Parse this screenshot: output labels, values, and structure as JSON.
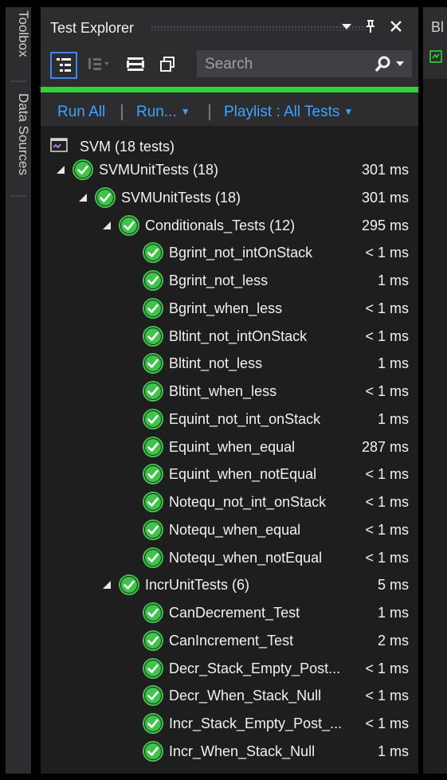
{
  "side_tabs": [
    "Toolbox",
    "Data Sources"
  ],
  "panel": {
    "title": "Test Explorer",
    "search_placeholder": "Search",
    "progress": 1.0,
    "progress_color": "#2bd636",
    "accent_color": "#3ea3ff"
  },
  "actions": {
    "run_all": "Run All",
    "run": "Run...",
    "playlist": "Playlist : All Tests"
  },
  "summary": {
    "label": "SVM (18 tests)"
  },
  "tree": [
    {
      "label": "SVMUnitTests (18)",
      "time": "301 ms",
      "level": 0,
      "expandable": true
    },
    {
      "label": "SVMUnitTests (18)",
      "time": "301 ms",
      "level": 1,
      "expandable": true
    },
    {
      "label": "Conditionals_Tests (12)",
      "time": "295 ms",
      "level": 2,
      "expandable": true
    },
    {
      "label": "Bgrint_not_intOnStack",
      "time": "< 1 ms",
      "level": 3,
      "expandable": false
    },
    {
      "label": "Bgrint_not_less",
      "time": "1 ms",
      "level": 3,
      "expandable": false
    },
    {
      "label": "Bgrint_when_less",
      "time": "< 1 ms",
      "level": 3,
      "expandable": false
    },
    {
      "label": "Bltint_not_intOnStack",
      "time": "< 1 ms",
      "level": 3,
      "expandable": false
    },
    {
      "label": "Bltint_not_less",
      "time": "1 ms",
      "level": 3,
      "expandable": false
    },
    {
      "label": "Bltint_when_less",
      "time": "< 1 ms",
      "level": 3,
      "expandable": false
    },
    {
      "label": "Equint_not_int_onStack",
      "time": "1 ms",
      "level": 3,
      "expandable": false
    },
    {
      "label": "Equint_when_equal",
      "time": "287 ms",
      "level": 3,
      "expandable": false
    },
    {
      "label": "Equint_when_notEqual",
      "time": "< 1 ms",
      "level": 3,
      "expandable": false
    },
    {
      "label": "Notequ_not_int_onStack",
      "time": "< 1 ms",
      "level": 3,
      "expandable": false
    },
    {
      "label": "Notequ_when_equal",
      "time": "< 1 ms",
      "level": 3,
      "expandable": false
    },
    {
      "label": "Notequ_when_notEqual",
      "time": "< 1 ms",
      "level": 3,
      "expandable": false
    },
    {
      "label": "IncrUnitTests (6)",
      "time": "5 ms",
      "level": 2,
      "expandable": true
    },
    {
      "label": "CanDecrement_Test",
      "time": "1 ms",
      "level": 3,
      "expandable": false
    },
    {
      "label": "CanIncrement_Test",
      "time": "2 ms",
      "level": 3,
      "expandable": false
    },
    {
      "label": "Decr_Stack_Empty_Post...",
      "time": "< 1 ms",
      "level": 3,
      "expandable": false
    },
    {
      "label": "Decr_When_Stack_Null",
      "time": "< 1 ms",
      "level": 3,
      "expandable": false
    },
    {
      "label": "Incr_Stack_Empty_Post_...",
      "time": "< 1 ms",
      "level": 3,
      "expandable": false
    },
    {
      "label": "Incr_When_Stack_Null",
      "time": "1 ms",
      "level": 3,
      "expandable": false
    }
  ],
  "right_panel": {
    "tab_text": "Bl"
  }
}
